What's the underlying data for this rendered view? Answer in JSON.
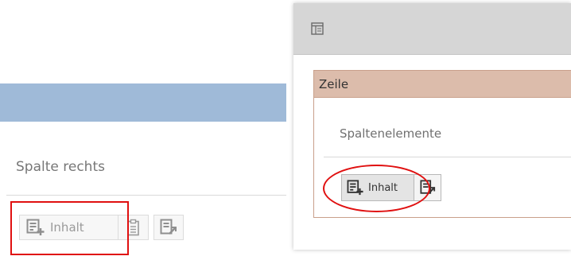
{
  "left": {
    "heading": "Spalte rechts",
    "content_button_label": "Inhalt",
    "icons": {
      "add_content": "add-content-icon",
      "paste": "clipboard-icon",
      "more": "edit-export-icon"
    }
  },
  "right_panel": {
    "header_icon": "layout-icon",
    "row_title": "Zeile",
    "column_elements_label": "Spaltenelemente",
    "content_button_label": "Inhalt",
    "icons": {
      "add_content": "add-content-icon",
      "more": "edit-export-icon"
    }
  },
  "colors": {
    "left_bar": "#9fbad8",
    "row_header": "#dcbcab",
    "row_border": "#c9a08b",
    "highlight": "#e01010",
    "panel_header": "#d6d6d6"
  }
}
